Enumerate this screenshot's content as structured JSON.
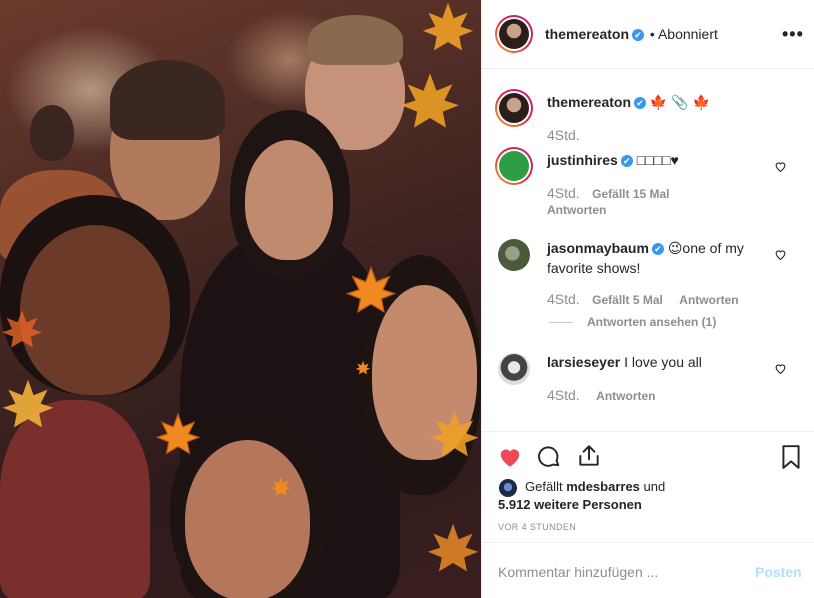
{
  "header": {
    "username": "themereaton",
    "verified_mark": "✔",
    "follow_status": "• Abonniert",
    "more_label": "•••"
  },
  "caption": {
    "username": "themereaton",
    "text": "🍁 📎 🍁",
    "time": "4Std."
  },
  "comments": [
    {
      "username": "justinhires",
      "text": "□□□□♥",
      "time": "4Std.",
      "likes": "Gefällt 15 Mal",
      "reply": "Antworten",
      "avatar_color": "#2e9e44"
    },
    {
      "username": "jasonmaybaum",
      "text": "😉one of my favorite shows!",
      "time": "4Std.",
      "likes": "Gefällt 5 Mal",
      "reply": "Antworten",
      "view_replies": "Antworten ansehen (1)",
      "avatar_color": "#4a5a3a"
    },
    {
      "username": "larsieseyer",
      "text": "I love you all",
      "time": "4Std.",
      "reply": "Antworten",
      "avatar_color": "#6a6a6a"
    }
  ],
  "actions": {
    "liked": true,
    "like_color": "#ed4956",
    "liked_by_prefix": "Gefällt",
    "liked_by_user": "mdesbarres",
    "liked_by_connector": "und",
    "liked_by_others": "5.912 weitere Personen",
    "timestamp": "VOR 4 STUNDEN"
  },
  "composer": {
    "placeholder": "Kommentar hinzufügen ...",
    "post_label": "Posten"
  },
  "icons": [
    "heart-icon",
    "comment-icon",
    "share-icon",
    "bookmark-icon",
    "more-icon",
    "verified-icon"
  ]
}
